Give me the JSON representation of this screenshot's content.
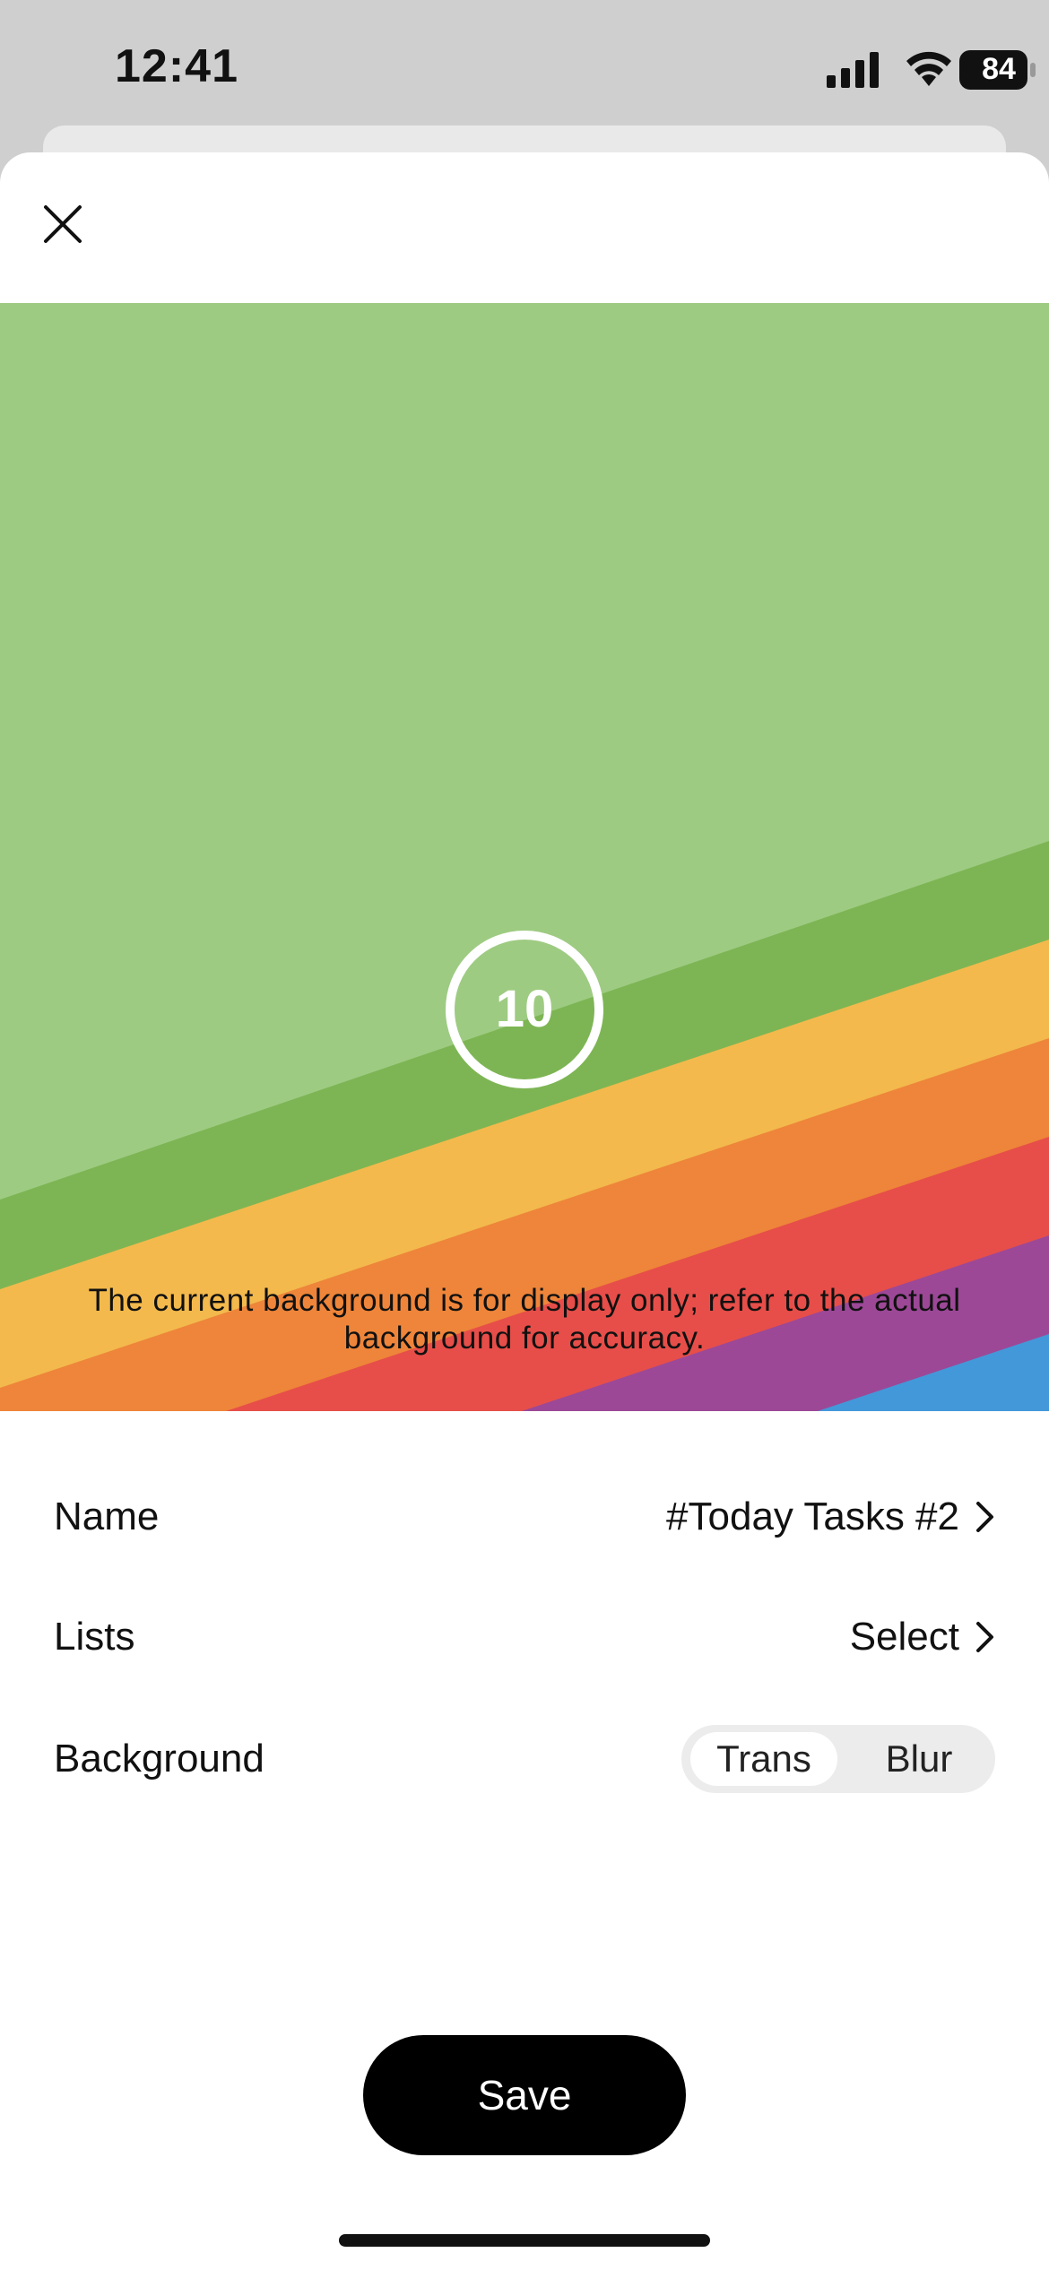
{
  "status_bar": {
    "time": "12:41",
    "battery": "84"
  },
  "preview": {
    "counter_value": "10",
    "note": "The current background is for display only; refer to the actual background for accuracy.",
    "colors": {
      "background": "#9ecb82",
      "stripes": [
        "#7db554",
        "#f3b94c",
        "#ee853a",
        "#e74e49",
        "#9c4897",
        "#4398d9"
      ]
    }
  },
  "settings": {
    "name": {
      "label": "Name",
      "value": "#Today Tasks #2"
    },
    "lists": {
      "label": "Lists",
      "value": "Select"
    },
    "background": {
      "label": "Background",
      "options": [
        "Trans",
        "Blur"
      ],
      "selected": "Trans"
    }
  },
  "actions": {
    "save_label": "Save"
  }
}
